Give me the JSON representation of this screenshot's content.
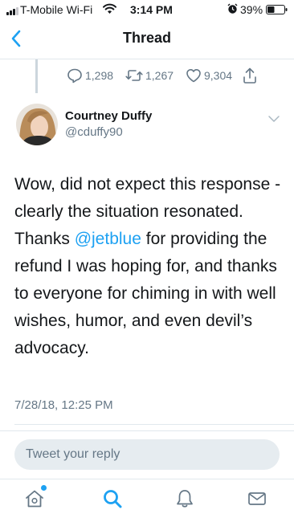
{
  "status_bar": {
    "carrier": "T-Mobile Wi-Fi",
    "time": "3:14 PM",
    "battery": "39%"
  },
  "nav": {
    "title": "Thread"
  },
  "parent_tweet": {
    "replies": "1,298",
    "retweets": "1,267",
    "likes": "9,304"
  },
  "tweet": {
    "display_name": "Courtney Duffy",
    "username": "@cduffy90",
    "text_before": "Wow, did not expect this response - clearly the situation resonated. Thanks ",
    "mention": "@jetblue",
    "text_after": " for providing the refund I was hoping for, and thanks to everyone for chiming in with well wishes, humor, and even devil’s advocacy.",
    "timestamp": "7/28/18, 12:25 PM"
  },
  "reply_bar": {
    "placeholder": "Tweet your reply"
  },
  "tab_bar": {
    "items": [
      "home-icon",
      "search-icon",
      "notifications-icon",
      "messages-icon"
    ]
  },
  "colors": {
    "accent": "#1da1f2",
    "secondary_text": "#657786",
    "divider": "#e1e8ed",
    "reply_field": "#e6ecf0"
  }
}
